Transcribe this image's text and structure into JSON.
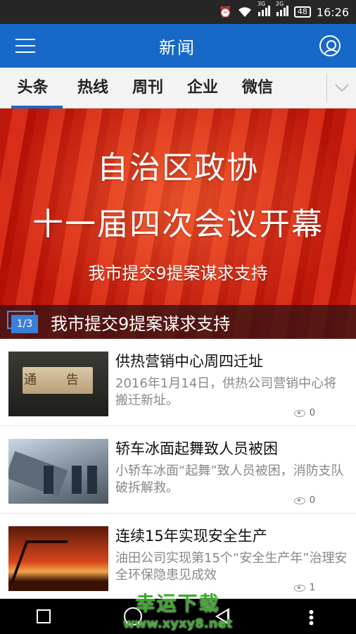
{
  "status_bar": {
    "battery": "48",
    "time": "16:26",
    "net1": "3G",
    "net2": "2G"
  },
  "app_bar": {
    "title": "新闻"
  },
  "tabs": [
    {
      "label": "头条"
    },
    {
      "label": "热线"
    },
    {
      "label": "周刊"
    },
    {
      "label": "企业"
    },
    {
      "label": "微信"
    }
  ],
  "banner": {
    "line1": "自治区政协",
    "line2": "十一届四次会议开幕",
    "line3": "我市提交9提案谋求支持",
    "pager": "1/3",
    "caption": "我市提交9提案谋求支持"
  },
  "news": [
    {
      "thumb_text": "通 告",
      "headline": "供热营销中心周四迁址",
      "summary": "2016年1月14日，供热公司营销中心将搬迁新址。",
      "views": "0"
    },
    {
      "headline": "轿车冰面起舞致人员被困",
      "summary": "小轿车冰面“起舞”致人员被困，消防支队破拆解救。",
      "views": "0"
    },
    {
      "headline": "连续15年实现安全生产",
      "summary": "油田公司实现第15个“安全生产年”治理安全环保隐患见成效",
      "views": "1"
    }
  ],
  "watermark": {
    "line1": "幸运下载",
    "line2": "www.xyxy8.net"
  }
}
